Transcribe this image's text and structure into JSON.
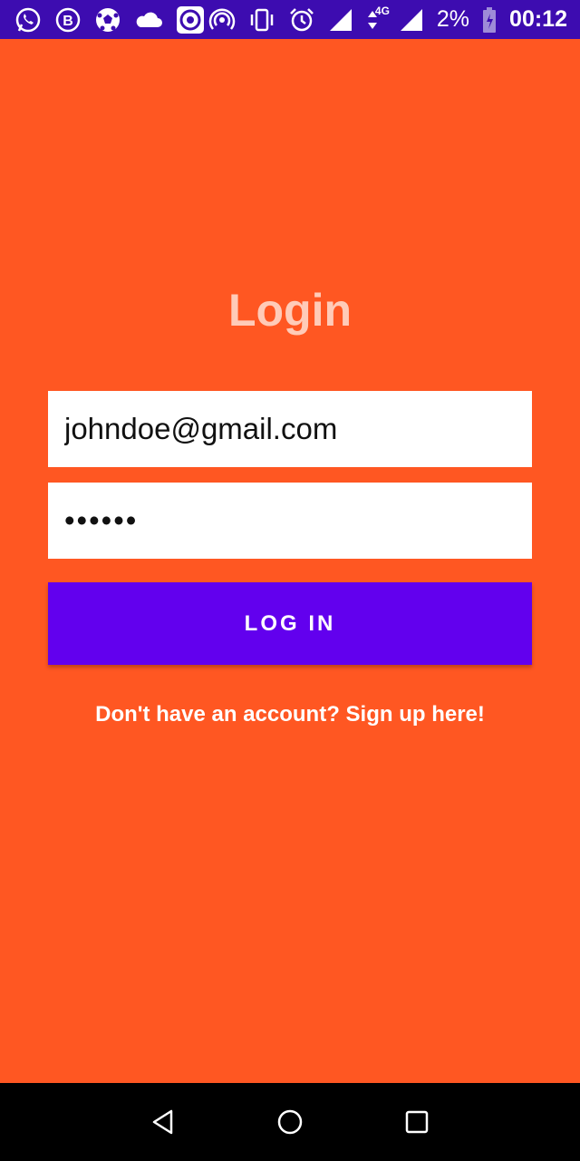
{
  "status_bar": {
    "left_icons": [
      "whatsapp-icon",
      "b-badge-icon",
      "soccer-ball-icon",
      "cloud-icon",
      "target-app-icon"
    ],
    "right_icons": [
      "hotspot-icon",
      "vibrate-icon",
      "alarm-icon",
      "signal-icon",
      "network-4g-icon",
      "signal-2-icon",
      "battery-icon"
    ],
    "network_label": "4G",
    "battery_percent": "2%",
    "time": "00:12"
  },
  "login": {
    "title": "Login",
    "email_value": "johndoe@gmail.com",
    "password_value": "••••••",
    "login_button_label": "LOG IN",
    "signup_text": "Don't have an account? Sign up here!"
  },
  "colors": {
    "background": "#FF5722",
    "status_bar": "#3D0CB0",
    "button": "#6200EE",
    "title": "#FFCBB8"
  },
  "nav_bar": {
    "buttons": [
      "back-icon",
      "home-icon",
      "recents-icon"
    ]
  }
}
